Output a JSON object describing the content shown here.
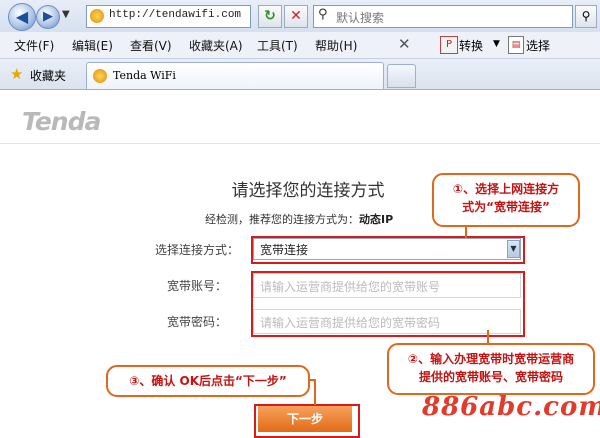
{
  "browser": {
    "url": "http://tendawifi.com",
    "search_placeholder": "默认搜索",
    "menus": [
      "文件(F)",
      "编辑(E)",
      "查看(V)",
      "收藏夹(A)",
      "工具(T)",
      "帮助(H)"
    ],
    "convert_label": "转换",
    "select_label": "选择",
    "favorites_label": "收藏夹",
    "tab_title": "Tenda WiFi"
  },
  "page": {
    "logo": "Tenda",
    "title": "请选择您的连接方式",
    "detect_prefix": "经检测，推荐您的连接方式为：",
    "detect_value": "动态IP",
    "connection_label": "选择连接方式：",
    "connection_value": "宽带连接",
    "account_label": "宽带账号：",
    "account_placeholder": "请输入运营商提供给您的宽带账号",
    "password_label": "宽带密码：",
    "password_placeholder": "请输入运营商提供给您的宽带密码",
    "next_label": "下一步"
  },
  "annotations": {
    "callout_1_line1": "①、选择上网连接方",
    "callout_1_line2": "式为“宽带连接”",
    "callout_2_line1": "②、输入办理宽带时宽带运营商",
    "callout_2_line2": "提供的宽带账号、宽带密码",
    "callout_3": "③、确认 OK后点击“下一步”",
    "watermark": "886abc.com",
    "accent_color": "#e0681b",
    "highlight_color": "#d91a1a"
  }
}
